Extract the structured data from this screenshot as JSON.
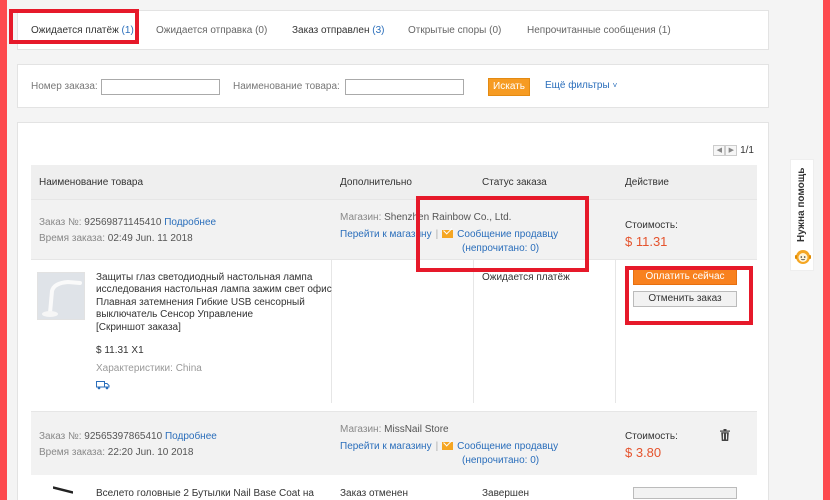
{
  "tabs": [
    {
      "label": "Ожидается платёж",
      "count": "(1)"
    },
    {
      "label": "Ожидается отправка",
      "count": "(0)"
    },
    {
      "label": "Заказ отправлен",
      "count": "(3)"
    },
    {
      "label": "Открытые споры",
      "count": "(0)"
    },
    {
      "label": "Непрочитанные сообщения",
      "count": "(1)"
    }
  ],
  "search": {
    "order_number_label": "Номер заказа:",
    "product_name_label": "Наименование товара:",
    "order_number_value": "",
    "product_name_value": "",
    "search_button": "Искать",
    "more_filters": "Ещё фильтры"
  },
  "pager": {
    "text": "1/1"
  },
  "columns": {
    "product": "Наименование товара",
    "extra": "Дополнительно",
    "status": "Статус заказа",
    "action": "Действие"
  },
  "orders": [
    {
      "number_label": "Заказ №:",
      "number": "92569871145410",
      "details": "Подробнее",
      "time_label": "Время заказа:",
      "time": "02:49 Jun. 11 2018",
      "store_label": "Магазин:",
      "store": "Shenzhen Rainbow Co., Ltd.",
      "goto_store": "Перейти к магазину",
      "message_seller": "Сообщение продавцу",
      "unread": "(непрочитано: 0)",
      "cost_label": "Стоимость:",
      "cost": "$ 11.31",
      "product_title": "Защиты глаз светодиодный настольная лампа исследования настольная лампа зажим свет офис Плавная затемнения Гибкие USB сенсорный выключатель Сенсор Управление",
      "snapshot": "[Скриншот заказа]",
      "price": "$ 11.31 X1",
      "properties": "Характеристики: China",
      "status": "Ожидается платёж",
      "pay_button": "Оплатить сейчас",
      "cancel_button": "Отменить заказ"
    },
    {
      "number_label": "Заказ №:",
      "number": "92565397865410",
      "details": "Подробнее",
      "time_label": "Время заказа:",
      "time": "22:20 Jun. 10 2018",
      "store_label": "Магазин:",
      "store": "MissNail Store",
      "goto_store": "Перейти к магазину",
      "message_seller": "Сообщение продавцу",
      "unread": "(непрочитано: 0)",
      "cost_label": "Стоимость:",
      "cost": "$ 3.80"
    }
  ],
  "partial_row": {
    "product_start": "Вселето головные 2 Бутылки Nail Base Coat на",
    "extra": "Заказ отменен",
    "status": "Завершен"
  },
  "help": {
    "label": "Нужна помощь"
  },
  "colors": {
    "accent_orange": "#f8811f",
    "link_blue": "#2a6ebb",
    "highlight_red": "#e6192a",
    "price_red": "#e5532d"
  }
}
